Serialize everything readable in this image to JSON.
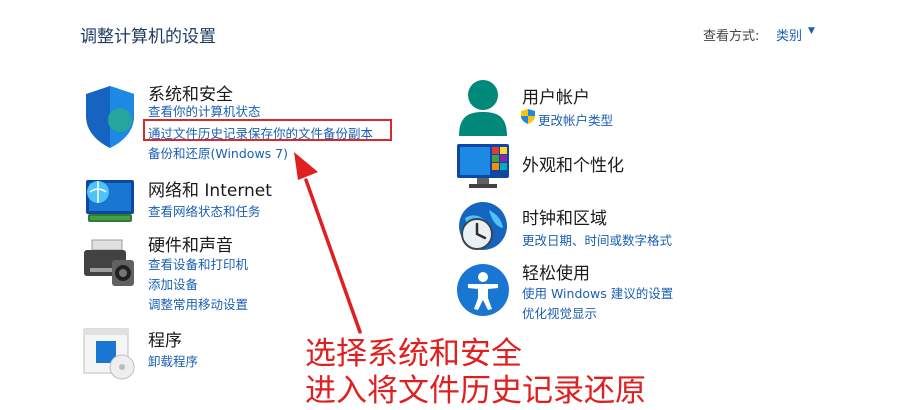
{
  "window": {
    "title": "调整计算机的设置"
  },
  "view": {
    "label": "查看方式:",
    "value": "类别"
  },
  "categories": {
    "system": {
      "title": "系统和安全",
      "links": [
        "查看你的计算机状态",
        "通过文件历史记录保存你的文件备份副本",
        "备份和还原(Windows 7)"
      ]
    },
    "network": {
      "title": "网络和 Internet",
      "links": [
        "查看网络状态和任务"
      ]
    },
    "hardware": {
      "title": "硬件和声音",
      "links": [
        "查看设备和打印机",
        "添加设备",
        "调整常用移动设置"
      ]
    },
    "programs": {
      "title": "程序",
      "links": [
        "卸载程序"
      ]
    },
    "user": {
      "title": "用户帐户",
      "links": [
        "更改帐户类型"
      ]
    },
    "appearance": {
      "title": "外观和个性化",
      "links": []
    },
    "clock": {
      "title": "时钟和区域",
      "links": [
        "更改日期、时间或数字格式"
      ]
    },
    "ease": {
      "title": "轻松使用",
      "links": [
        "使用 Windows 建议的设置",
        "优化视觉显示"
      ]
    }
  },
  "annotation": {
    "line1": "选择系统和安全",
    "line2": "进入将文件历史记录还原"
  },
  "colors": {
    "highlight": "#d62b2b",
    "link": "#1a5fb4",
    "annotation": "#e02020"
  }
}
